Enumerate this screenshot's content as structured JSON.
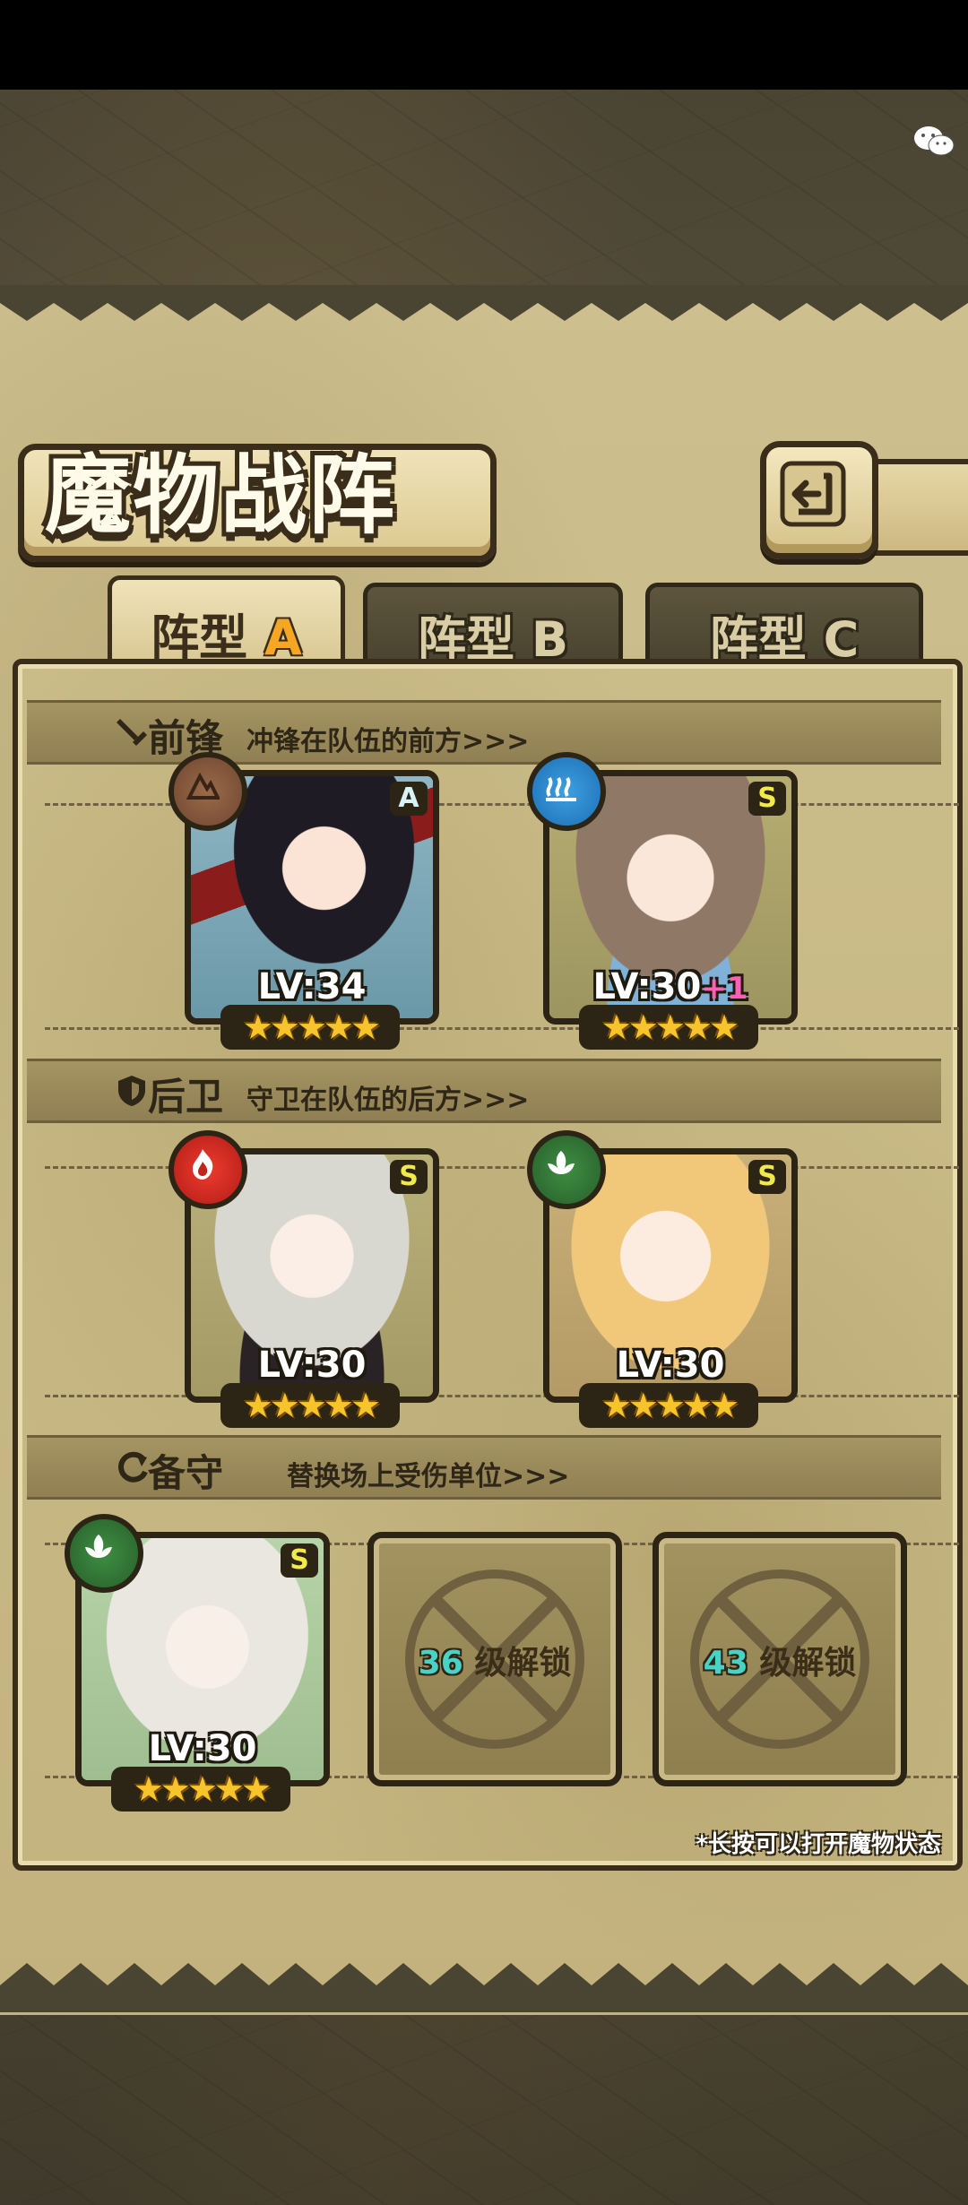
{
  "title": "魔物战阵",
  "tabs": [
    {
      "label": "阵型",
      "letter": "A",
      "active": true
    },
    {
      "label": "阵型",
      "letter": "B",
      "active": false
    },
    {
      "label": "阵型",
      "letter": "C",
      "active": false
    }
  ],
  "sections": {
    "front": {
      "title": "前锋",
      "desc": "冲锋在队伍的前方>>>"
    },
    "back": {
      "title": "后卫",
      "desc": "守卫在队伍的后方>>>"
    },
    "reserve": {
      "title": "备守",
      "desc": "替换场上受伤单位>>>"
    }
  },
  "units": [
    {
      "rank": "A",
      "level": "LV:34",
      "plus": "",
      "stars": "★★★★★",
      "element": "earth",
      "portrait": "dark-haired-girl-with-red-blade"
    },
    {
      "rank": "S",
      "level": "LV:30",
      "plus": "+1",
      "stars": "★★★★★",
      "element": "water",
      "portrait": "brown-haired-girl-with-bell"
    },
    {
      "rank": "S",
      "level": "LV:30",
      "plus": "",
      "stars": "★★★★★",
      "element": "fire",
      "portrait": "white-haired-girl-in-black"
    },
    {
      "rank": "S",
      "level": "LV:30",
      "plus": "",
      "stars": "★★★★★",
      "element": "leaf",
      "portrait": "blonde-girl-with-wings"
    },
    {
      "rank": "S",
      "level": "LV:30",
      "plus": "",
      "stars": "★★★★★",
      "element": "leaf",
      "portrait": "white-haired-girl-with-laurel"
    }
  ],
  "locked_slots": [
    {
      "level": "36",
      "text": "级解锁"
    },
    {
      "level": "43",
      "text": "级解锁"
    }
  ],
  "hint": "*长按可以打开魔物状态",
  "colors": {
    "accent": "#f5a623",
    "rank_s": "#f2e94a",
    "rank_a": "#bfe9f2",
    "unlock_level": "#48d3c7",
    "plus": "#ff5fb5"
  }
}
